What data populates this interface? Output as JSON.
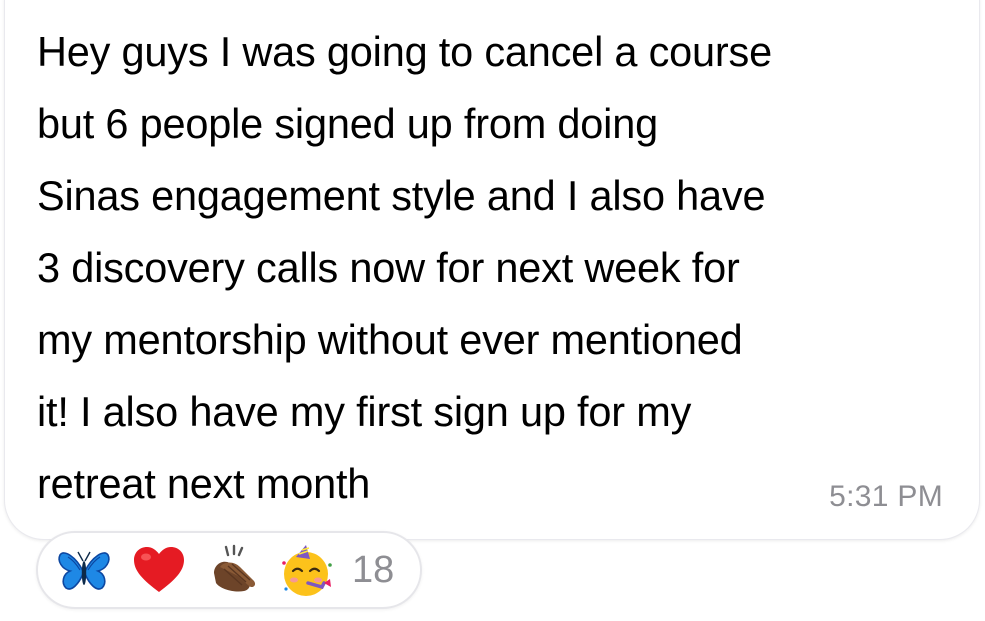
{
  "message": {
    "text": "Hey guys I was going to cancel a course\nbut 6 people signed up from doing\nSinas engagement style and I also have\n3 discovery calls now for next week for\nmy mentorship without ever mentioned\nit! I also have my first sign up for my\nretreat next month",
    "timestamp": "5:31 PM"
  },
  "reactions": {
    "icons": [
      "butterfly-icon",
      "red-heart-icon",
      "clapping-hands-icon",
      "partying-face-icon"
    ],
    "count": "18"
  },
  "colors": {
    "background": "#ffffff",
    "text": "#000000",
    "timestamp": "#8e8e93",
    "bubble_border": "#e9e9ee",
    "butterfly": "#1e88e5",
    "heart": "#e51b23",
    "hands": "#8a5a36",
    "face": "#fcc21b"
  }
}
